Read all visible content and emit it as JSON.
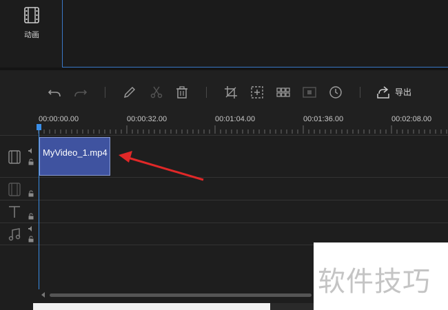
{
  "left_panel": {
    "animation_label": "动画",
    "animation_icon": "film-icon"
  },
  "toolbar": {
    "undo_icon": "undo-icon",
    "redo_icon": "redo-icon",
    "edit_icon": "pencil-icon",
    "cut_icon": "scissors-icon",
    "delete_icon": "trash-icon",
    "crop_icon": "crop-icon",
    "zoom_icon": "zoom-frame-icon",
    "mosaic_icon": "mosaic-icon",
    "freeze_icon": "freeze-frame-icon",
    "duration_icon": "clock-icon",
    "export_icon": "export-icon",
    "export_label": "导出"
  },
  "ruler": {
    "ticks": [
      "00:00:00.00",
      "00:00:32.00",
      "00:01:04.00",
      "00:01:36.00",
      "00:02:08.00"
    ]
  },
  "tracks": {
    "video_clip": {
      "label": "MyVideo_1.mp4"
    }
  },
  "watermark": {
    "text": "软件技巧"
  },
  "colors": {
    "accent": "#3a8ee8",
    "clip": "#3f53a0",
    "annotation": "#e02828"
  }
}
